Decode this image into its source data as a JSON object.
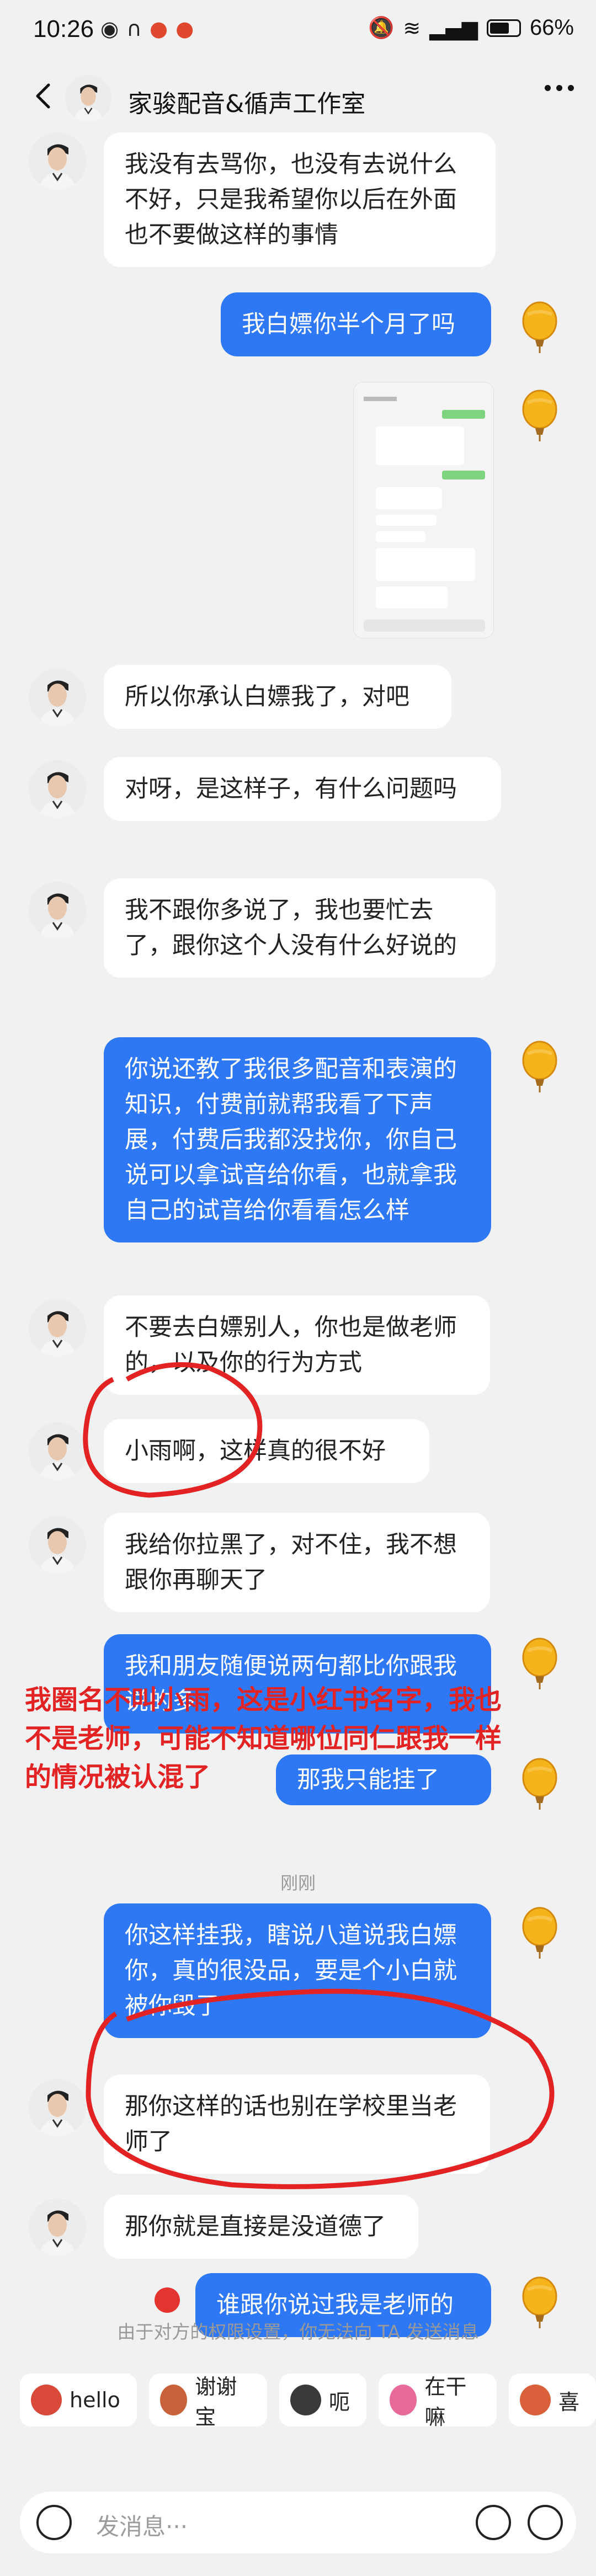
{
  "status": {
    "time": "10:26",
    "battery": "66%",
    "battery_level": 0.66
  },
  "header": {
    "title": "家骏配音&循声工作室"
  },
  "messages": [
    {
      "side": "in",
      "text": "我没有去骂你，也没有去说什么不好，只是我希望你以后在外面也不要做这样的事情"
    },
    {
      "side": "out",
      "text": "我白嫖你半个月了吗"
    },
    {
      "side": "out",
      "type": "image"
    },
    {
      "side": "in",
      "text": "所以你承认白嫖我了，对吧"
    },
    {
      "side": "in",
      "text": "对呀，是这样子，有什么问题吗"
    },
    {
      "side": "in",
      "text": "我不跟你多说了，我也要忙去了，跟你这个人没有什么好说的"
    },
    {
      "side": "out",
      "text": "你说还教了我很多配音和表演的知识，付费前就帮我看了下声展，付费后我都没找你，你自己说可以拿试音给你看，也就拿我自己的试音给你看看怎么样"
    },
    {
      "side": "in",
      "text": "不要去白嫖别人，你也是做老师的，以及你的行为方式"
    },
    {
      "side": "in",
      "text": "小雨啊，这样真的很不好"
    },
    {
      "side": "in",
      "text": "我给你拉黑了，对不住，我不想跟你再聊天了"
    },
    {
      "side": "out",
      "text": "我和朋友随便说两句都比你跟我说的多"
    },
    {
      "side": "out",
      "text": "那我只能挂了"
    },
    {
      "side": "out",
      "text": "你这样挂我，瞎说八道说我白嫖你，真的很没品，要是个小白就被你毁了"
    },
    {
      "side": "in",
      "text": "那你这样的话也别在学校里当老师了"
    },
    {
      "side": "in",
      "text": "那你就是直接是没道德了"
    },
    {
      "side": "out",
      "text": "谁跟你说过我是老师的"
    }
  ],
  "time_divider": "刚刚",
  "annotation": "我圈名不叫小雨，这是小红书名字，我也不是老师，可能不知道哪位同仁跟我一样的情况被认混了",
  "system_note": "由于对方的权限设置，你无法向 TA 发送消息",
  "quick_replies": [
    {
      "label": "hello",
      "emoji_color": "#d94a3a"
    },
    {
      "label": "谢谢宝",
      "emoji_color": "#c9623a"
    },
    {
      "label": "呃",
      "emoji_color": "#3a3a3a"
    },
    {
      "label": "在干嘛",
      "emoji_color": "#e86a9a"
    },
    {
      "label": "喜",
      "emoji_color": "#d9603a"
    }
  ],
  "input": {
    "placeholder": "发消息···"
  },
  "colors": {
    "bubble_out": "#2e78f5",
    "bubble_in": "#ffffff",
    "annotation_red": "#e32323",
    "background": "#f1f1f2"
  }
}
